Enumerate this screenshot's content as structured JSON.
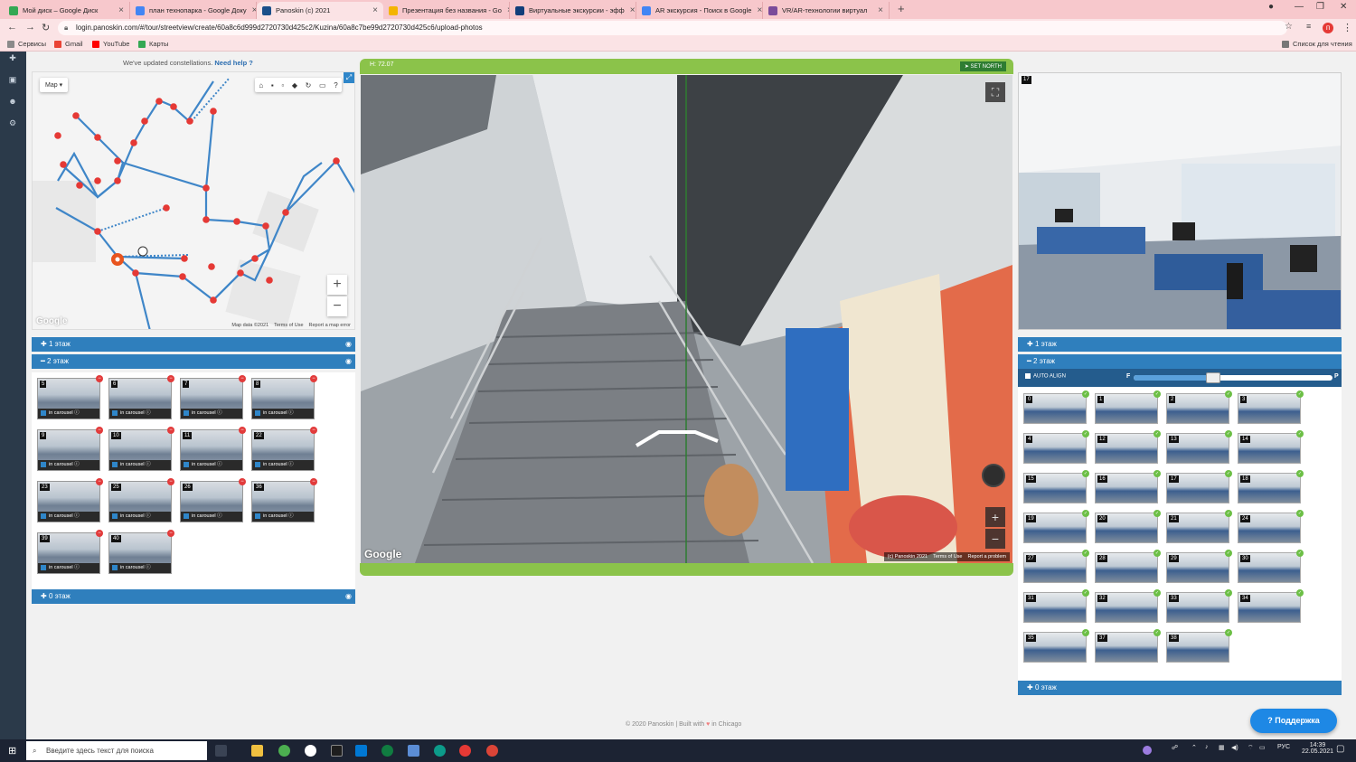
{
  "browser": {
    "tabs": [
      {
        "title": "Мой диск – Google Диск",
        "color": "#34a853"
      },
      {
        "title": "план технопарка - Google Доку",
        "color": "#4285f4"
      },
      {
        "title": "Panoskin (c) 2021",
        "color": "#1a4f8a"
      },
      {
        "title": "Презентация без названия - Go",
        "color": "#f4b400"
      },
      {
        "title": "Виртуальные экскурсии - эфф",
        "color": "#123e7a"
      },
      {
        "title": "AR экскурсия - Поиск в Google",
        "color": "#4285f4"
      },
      {
        "title": "VR/AR-технологии виртуал",
        "color": "#7a4b9a"
      }
    ],
    "url": "login.panoskin.com/#/tour/streetview/create/60a8c6d999d2720730d425c2/Kuzina/60a8c7be99d2720730d425c6/upload-photos",
    "bookmarks": [
      "Сервисы",
      "Gmail",
      "YouTube",
      "Карты"
    ],
    "reading_list": "Список для чтения",
    "profile": "п"
  },
  "notice": {
    "text": "We've updated constellations.",
    "link": "Need help"
  },
  "map": {
    "type_label": "Map",
    "google_label": "Google",
    "footer": [
      "Map data ©2021",
      "Terms of Use",
      "Report a map error"
    ],
    "zoom_in": "+",
    "zoom_out": "−"
  },
  "left_sections": {
    "floor1": "1 этаж",
    "floor2": "2 этаж",
    "floor0": "0 этаж"
  },
  "left_thumbs": [
    {
      "num": "5"
    },
    {
      "num": "6"
    },
    {
      "num": "7"
    },
    {
      "num": "8"
    },
    {
      "num": "9"
    },
    {
      "num": "10"
    },
    {
      "num": "11"
    },
    {
      "num": "22"
    },
    {
      "num": "23"
    },
    {
      "num": "25"
    },
    {
      "num": "26"
    },
    {
      "num": "36"
    },
    {
      "num": "39"
    },
    {
      "num": "40"
    }
  ],
  "carousel_label": "in carousel",
  "pano": {
    "heading": "H: 72.07",
    "set_north": "SET NORTH",
    "google_label": "Google",
    "footer": [
      "(c) Panoskin 2021",
      "Terms of Use",
      "Report a problem"
    ]
  },
  "preview": {
    "num": "17"
  },
  "right_sections": {
    "floor1": "1 этаж",
    "floor2": "2 этаж",
    "floor0": "0 этаж",
    "auto_align": "AUTO ALIGN",
    "slider_left": "F",
    "slider_right": "P",
    "slider_value": 0.4
  },
  "right_thumbs": [
    {
      "num": "0"
    },
    {
      "num": "1"
    },
    {
      "num": "2"
    },
    {
      "num": "3"
    },
    {
      "num": "4"
    },
    {
      "num": "12"
    },
    {
      "num": "13"
    },
    {
      "num": "14"
    },
    {
      "num": "15"
    },
    {
      "num": "16"
    },
    {
      "num": "17"
    },
    {
      "num": "18"
    },
    {
      "num": "19"
    },
    {
      "num": "20"
    },
    {
      "num": "21"
    },
    {
      "num": "24"
    },
    {
      "num": "27"
    },
    {
      "num": "28"
    },
    {
      "num": "29"
    },
    {
      "num": "30"
    },
    {
      "num": "31"
    },
    {
      "num": "32"
    },
    {
      "num": "33"
    },
    {
      "num": "34"
    },
    {
      "num": "35"
    },
    {
      "num": "37"
    },
    {
      "num": "38"
    }
  ],
  "footer": {
    "text": "© 2020 Panoskin | Built with",
    "city": "in Chicago"
  },
  "support": "Поддержка",
  "taskbar": {
    "search_placeholder": "Введите здесь текст для поиска",
    "lang": "РУС",
    "time": "14:39",
    "date": "22.05.2021"
  }
}
